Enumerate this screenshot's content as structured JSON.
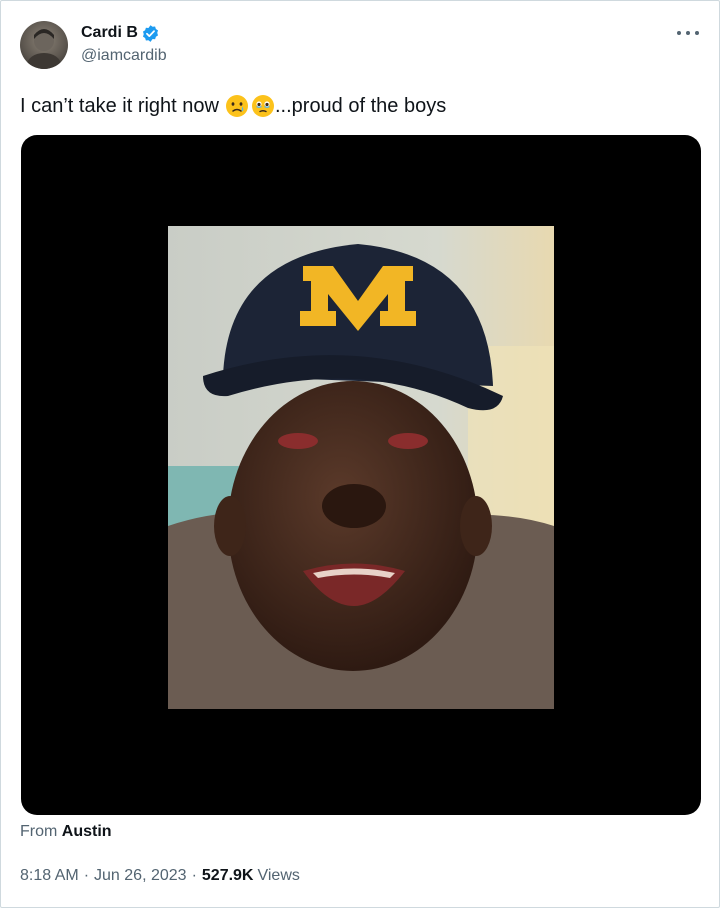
{
  "author": {
    "display_name": "Cardi B",
    "handle": "@iamcardib",
    "verified_badge_color": "#1d9bf0"
  },
  "icons": {
    "verified": "verified-badge-icon",
    "more": "more-options-icon",
    "emoji_1": "crying-face-emoji",
    "emoji_2": "holding-back-tears-emoji"
  },
  "tweet": {
    "text_before": "I can’t take it right now",
    "text_after": "...proud of the boys"
  },
  "media": {
    "type": "video",
    "background": "#000000",
    "cap_letter": "M",
    "cap_color": "#1c2436",
    "letter_color": "#f2b625"
  },
  "location": {
    "prefix": "From",
    "place": "Austin"
  },
  "meta": {
    "time": "8:18 AM",
    "date": "Jun 26, 2023",
    "separator": "·",
    "views_count": "527.9K",
    "views_label": "Views"
  }
}
